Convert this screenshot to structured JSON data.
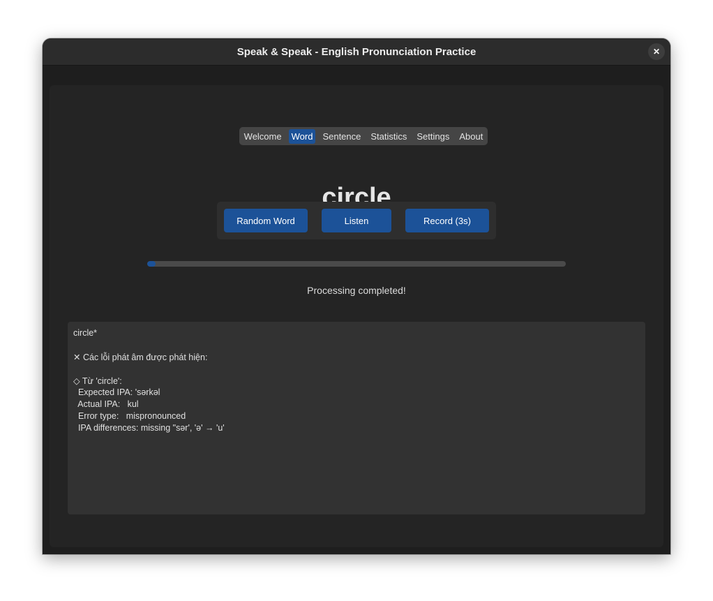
{
  "window": {
    "title": "Speak & Speak - English Pronunciation Practice",
    "close_glyph": "✕"
  },
  "tabs": [
    {
      "label": "Welcome",
      "active": false
    },
    {
      "label": "Word",
      "active": true
    },
    {
      "label": "Sentence",
      "active": false
    },
    {
      "label": "Statistics",
      "active": false
    },
    {
      "label": "Settings",
      "active": false
    },
    {
      "label": "About",
      "active": false
    }
  ],
  "word": "circle",
  "buttons": {
    "random": "Random Word",
    "listen": "Listen",
    "record": "Record (3s)"
  },
  "progress": {
    "fraction": 0.02
  },
  "status": "Processing completed!",
  "result": {
    "heading": "circle*",
    "errors_title": "✕ Các lỗi phát âm được phát hiện:",
    "word_item": "◇ Từ 'circle':",
    "expected": "  Expected IPA: 'sərkəl",
    "actual": "  Actual IPA:   kul",
    "error_type": "  Error type:   mispronounced",
    "ipa_diff": "  IPA differences: missing \"sər', 'ə' → 'u'"
  },
  "colors": {
    "accent": "#1c5298",
    "window_bg": "#1e1e1e",
    "panel_bg": "#242424",
    "result_bg": "#323232"
  }
}
